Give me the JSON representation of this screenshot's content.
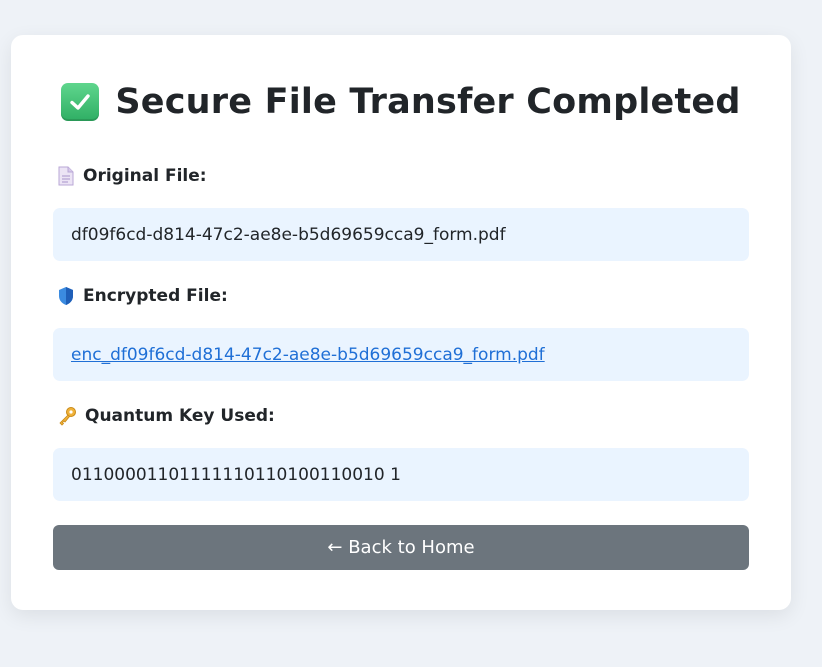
{
  "page": {
    "title": "Secure File Transfer Completed"
  },
  "original_file": {
    "label": "Original File:",
    "value": "df09f6cd-d814-47c2-ae8e-b5d69659cca9_form.pdf",
    "icon": "document-icon"
  },
  "encrypted_file": {
    "label": "Encrypted File:",
    "value": "enc_df09f6cd-d814-47c2-ae8e-b5d69659cca9_form.pdf",
    "icon": "shield-icon"
  },
  "quantum_key": {
    "label": "Quantum Key Used:",
    "value": "01100001101111110110100110010 1",
    "icon": "key-icon"
  },
  "actions": {
    "back_label": "← Back to Home"
  },
  "colors": {
    "background": "#eef2f7",
    "value_box": "#eaf4ff",
    "link": "#1f6fd6",
    "button": "#6c757d",
    "success": "#2fae64"
  }
}
